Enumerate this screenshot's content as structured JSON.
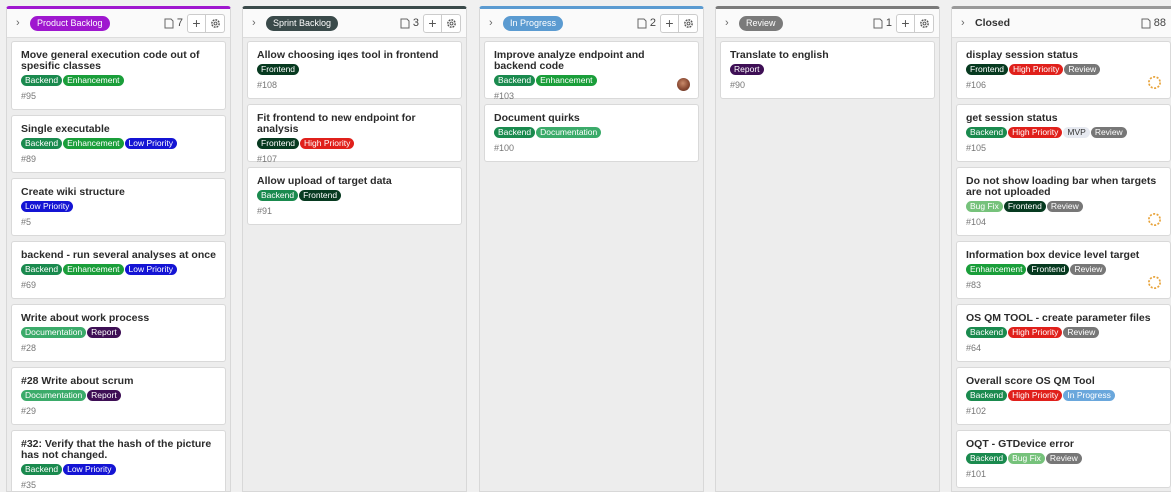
{
  "colors": {
    "backend": "#1a8a4e",
    "enhancement": "#1a9e3a",
    "low_priority": "#1414d4",
    "high_priority": "#e0201b",
    "frontend": "#073a20",
    "documentation": "#3bab6a",
    "report": "#3e0f55",
    "bug_fix": "#76c27b",
    "review": "#777777",
    "mvp": "#e6e9f0",
    "in_progress_label": "#6aa7dc",
    "product_backlog": "#9f17cf",
    "sprint_backlog": "#3a4a4a",
    "in_progress": "#5b9bd1",
    "review_col": "#7a7a7a"
  },
  "columns": [
    {
      "title": "Product Backlog",
      "style": "pill",
      "color": "#9f17cf",
      "count": "7",
      "cards": [
        {
          "title": "Move general execution code out of spesific classes",
          "labels": [
            [
              "Backend",
              "#1a8a4e"
            ],
            [
              "Enhancement",
              "#1a9e3a"
            ]
          ],
          "number": "#95",
          "tall": true
        },
        {
          "title": "Single executable",
          "labels": [
            [
              "Backend",
              "#1a8a4e"
            ],
            [
              "Enhancement",
              "#1a9e3a"
            ],
            [
              "Low Priority",
              "#1414d4"
            ]
          ],
          "number": "#89",
          "tall": false
        },
        {
          "title": "Create wiki structure",
          "labels": [
            [
              "Low Priority",
              "#1414d4"
            ]
          ],
          "number": "#5",
          "tall": false
        },
        {
          "title": "backend - run several analyses at once",
          "labels": [
            [
              "Backend",
              "#1a8a4e"
            ],
            [
              "Enhancement",
              "#1a9e3a"
            ],
            [
              "Low Priority",
              "#1414d4"
            ]
          ],
          "number": "#69",
          "tall": false
        },
        {
          "title": "Write about work process",
          "labels": [
            [
              "Documentation",
              "#3bab6a"
            ],
            [
              "Report",
              "#3e0f55"
            ]
          ],
          "number": "#28",
          "tall": false
        },
        {
          "title": "#28 Write about scrum",
          "labels": [
            [
              "Documentation",
              "#3bab6a"
            ],
            [
              "Report",
              "#3e0f55"
            ]
          ],
          "number": "#29",
          "tall": false
        },
        {
          "title": "#32: Verify that the hash of the picture has not changed.",
          "labels": [
            [
              "Backend",
              "#1a8a4e"
            ],
            [
              "Low Priority",
              "#1414d4"
            ]
          ],
          "number": "#35",
          "tall": true
        }
      ]
    },
    {
      "title": "Sprint Backlog",
      "style": "pill",
      "color": "#3a4a4a",
      "count": "3",
      "cards": [
        {
          "title": "Allow choosing iqes tool in frontend",
          "labels": [
            [
              "Frontend",
              "#073a20"
            ]
          ],
          "number": "#108",
          "tall": false
        },
        {
          "title": "Fit frontend to new endpoint for analysis",
          "labels": [
            [
              "Frontend",
              "#073a20"
            ],
            [
              "High Priority",
              "#e0201b"
            ]
          ],
          "number": "#107",
          "tall": false
        },
        {
          "title": "Allow upload of target data",
          "labels": [
            [
              "Backend",
              "#1a8a4e"
            ],
            [
              "Frontend",
              "#073a20"
            ]
          ],
          "number": "#91",
          "tall": false
        }
      ]
    },
    {
      "title": "In Progress",
      "style": "pill",
      "color": "#5b9bd1",
      "count": "2",
      "cards": [
        {
          "title": "Improve analyze endpoint and backend code",
          "labels": [
            [
              "Backend",
              "#1a8a4e"
            ],
            [
              "Enhancement",
              "#1a9e3a"
            ]
          ],
          "number": "#103",
          "tall": false,
          "avatar": true
        },
        {
          "title": "Document quirks",
          "labels": [
            [
              "Backend",
              "#1a8a4e"
            ],
            [
              "Documentation",
              "#3bab6a"
            ]
          ],
          "number": "#100",
          "tall": false
        }
      ]
    },
    {
      "title": "Review",
      "style": "pill",
      "color": "#7a7a7a",
      "count": "1",
      "cards": [
        {
          "title": "Translate to english",
          "labels": [
            [
              "Report",
              "#3e0f55"
            ]
          ],
          "number": "#90",
          "tall": false
        }
      ]
    },
    {
      "title": "Closed",
      "style": "plain",
      "color": "#999999",
      "count": "88",
      "cards": [
        {
          "title": "display session status",
          "labels": [
            [
              "Frontend",
              "#073a20"
            ],
            [
              "High Priority",
              "#e0201b"
            ],
            [
              "Review",
              "#777777"
            ]
          ],
          "number": "#106",
          "tall": false,
          "status": true
        },
        {
          "title": "get session status",
          "labels": [
            [
              "Backend",
              "#1a8a4e"
            ],
            [
              "High Priority",
              "#e0201b"
            ],
            [
              "MVP",
              "#e6e9f0"
            ],
            [
              "Review",
              "#777777"
            ]
          ],
          "number": "#105",
          "tall": false
        },
        {
          "title": "Do not show loading bar when targets are not uploaded",
          "labels": [
            [
              "Bug Fix",
              "#76c27b"
            ],
            [
              "Frontend",
              "#073a20"
            ],
            [
              "Review",
              "#777777"
            ]
          ],
          "number": "#104",
          "tall": true,
          "status": true
        },
        {
          "title": "Information box device level target",
          "labels": [
            [
              "Enhancement",
              "#1a9e3a"
            ],
            [
              "Frontend",
              "#073a20"
            ],
            [
              "Review",
              "#777777"
            ]
          ],
          "number": "#83",
          "tall": false,
          "status": true
        },
        {
          "title": "OS QM TOOL - create parameter files",
          "labels": [
            [
              "Backend",
              "#1a8a4e"
            ],
            [
              "High Priority",
              "#e0201b"
            ],
            [
              "Review",
              "#777777"
            ]
          ],
          "number": "#64",
          "tall": false
        },
        {
          "title": "Overall score OS QM Tool",
          "labels": [
            [
              "Backend",
              "#1a8a4e"
            ],
            [
              "High Priority",
              "#e0201b"
            ],
            [
              "In Progress",
              "#6aa7dc"
            ]
          ],
          "number": "#102",
          "tall": false
        },
        {
          "title": "OQT - GTDevice error",
          "labels": [
            [
              "Backend",
              "#1a8a4e"
            ],
            [
              "Bug Fix",
              "#76c27b"
            ],
            [
              "Review",
              "#777777"
            ]
          ],
          "number": "#101",
          "tall": false
        }
      ]
    }
  ]
}
